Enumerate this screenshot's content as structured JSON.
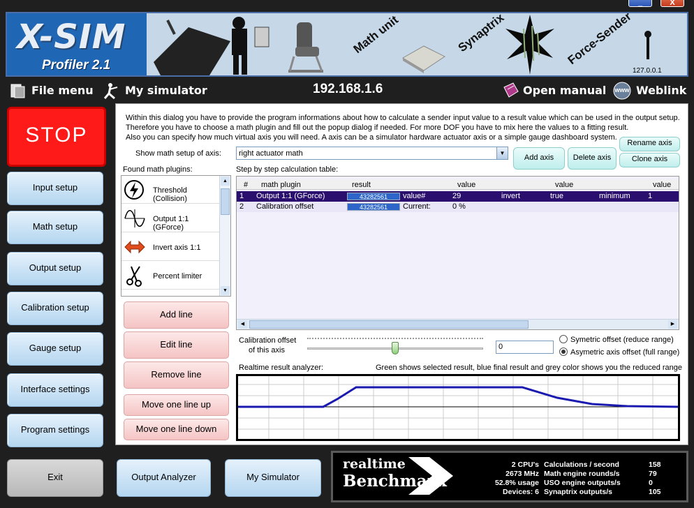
{
  "window": {
    "controls": [
      "_",
      "X"
    ]
  },
  "banner": {
    "logo_main": "X-SIM",
    "logo_sub": "Profiler 2.1",
    "labels": [
      "Math unit",
      "Synaptrix",
      "Force-Sender"
    ],
    "localhost": "127.0.0.1"
  },
  "toolbar": {
    "file_menu": "File menu",
    "my_simulator": "My simulator",
    "ip": "192.168.1.6",
    "open_manual": "Open manual",
    "weblink": "Weblink",
    "www_badge": "www"
  },
  "sidebar": {
    "stop": "STOP",
    "items": [
      "Input setup",
      "Math setup",
      "Output setup",
      "Calibration setup",
      "Gauge setup",
      "Interface settings",
      "Program settings"
    ],
    "exit": "Exit"
  },
  "intro": {
    "line1": "Within this dialog you have to provide the program informations about how to calculate a sender input value to a result value which can be used in the output setup.",
    "line2": "Therefore you have to choose a math plugin and fill out the popup dialog if needed. For more DOF you have to mix here the values to a fitting result.",
    "line3": "Also you can specify how much virtual axis you will need. A axis can be a simulator hardware actuator axis or a simple gauge dashboard system."
  },
  "axis": {
    "label": "Show math setup of axis:",
    "selected": "right actuator math",
    "add": "Add axis",
    "delete": "Delete axis",
    "rename": "Rename axis",
    "clone": "Clone axis"
  },
  "plugins": {
    "title": "Found math plugins:",
    "items": [
      "Threshold (Collision)",
      "Output 1:1 (GForce)",
      "Invert axis 1:1",
      "Percent limiter"
    ]
  },
  "calc_table": {
    "title": "Step by step calculation table:",
    "headers": [
      "#",
      "math plugin",
      "result",
      "",
      "value",
      "",
      "value",
      "",
      "value"
    ],
    "rows": [
      [
        "1",
        "Output 1:1 (GForce)",
        "43282561",
        "value#",
        "29",
        "invert",
        "true",
        "minimum",
        "1"
      ],
      [
        "2",
        "Calibration offset",
        "43282561",
        "Current:",
        "0 %",
        "",
        "",
        "",
        ""
      ]
    ]
  },
  "line_buttons": {
    "add": "Add line",
    "edit": "Edit line",
    "remove": "Remove line",
    "up": "Move one line up",
    "down": "Move one line down"
  },
  "calibration": {
    "label1": "Calibration offset",
    "label2": "of this axis",
    "value": "0",
    "slider_level": 0.5,
    "radio1": "Symetric offset (reduce range)",
    "radio2": "Asymetric axis offset (full range)",
    "radio_selected": 2
  },
  "analyzer": {
    "label": "Realtime result analyzer:",
    "legend": "Green shows selected result, blue final result and grey color shows you the reduced range"
  },
  "bottom": {
    "output_analyzer": "Output Analyzer",
    "my_simulator": "My Simulator"
  },
  "benchmark": {
    "logo1": "realtime",
    "logo2": "Benchmark",
    "col1": [
      "2 CPU's",
      "2673 MHz",
      "52.8% usage",
      "Devices: 6"
    ],
    "col2": [
      "Calculations / second",
      "Math engine rounds/s",
      "USO engine outputs/s",
      "Synaptrix outputs/s"
    ],
    "col3": [
      "158",
      "79",
      "0",
      "105"
    ]
  }
}
